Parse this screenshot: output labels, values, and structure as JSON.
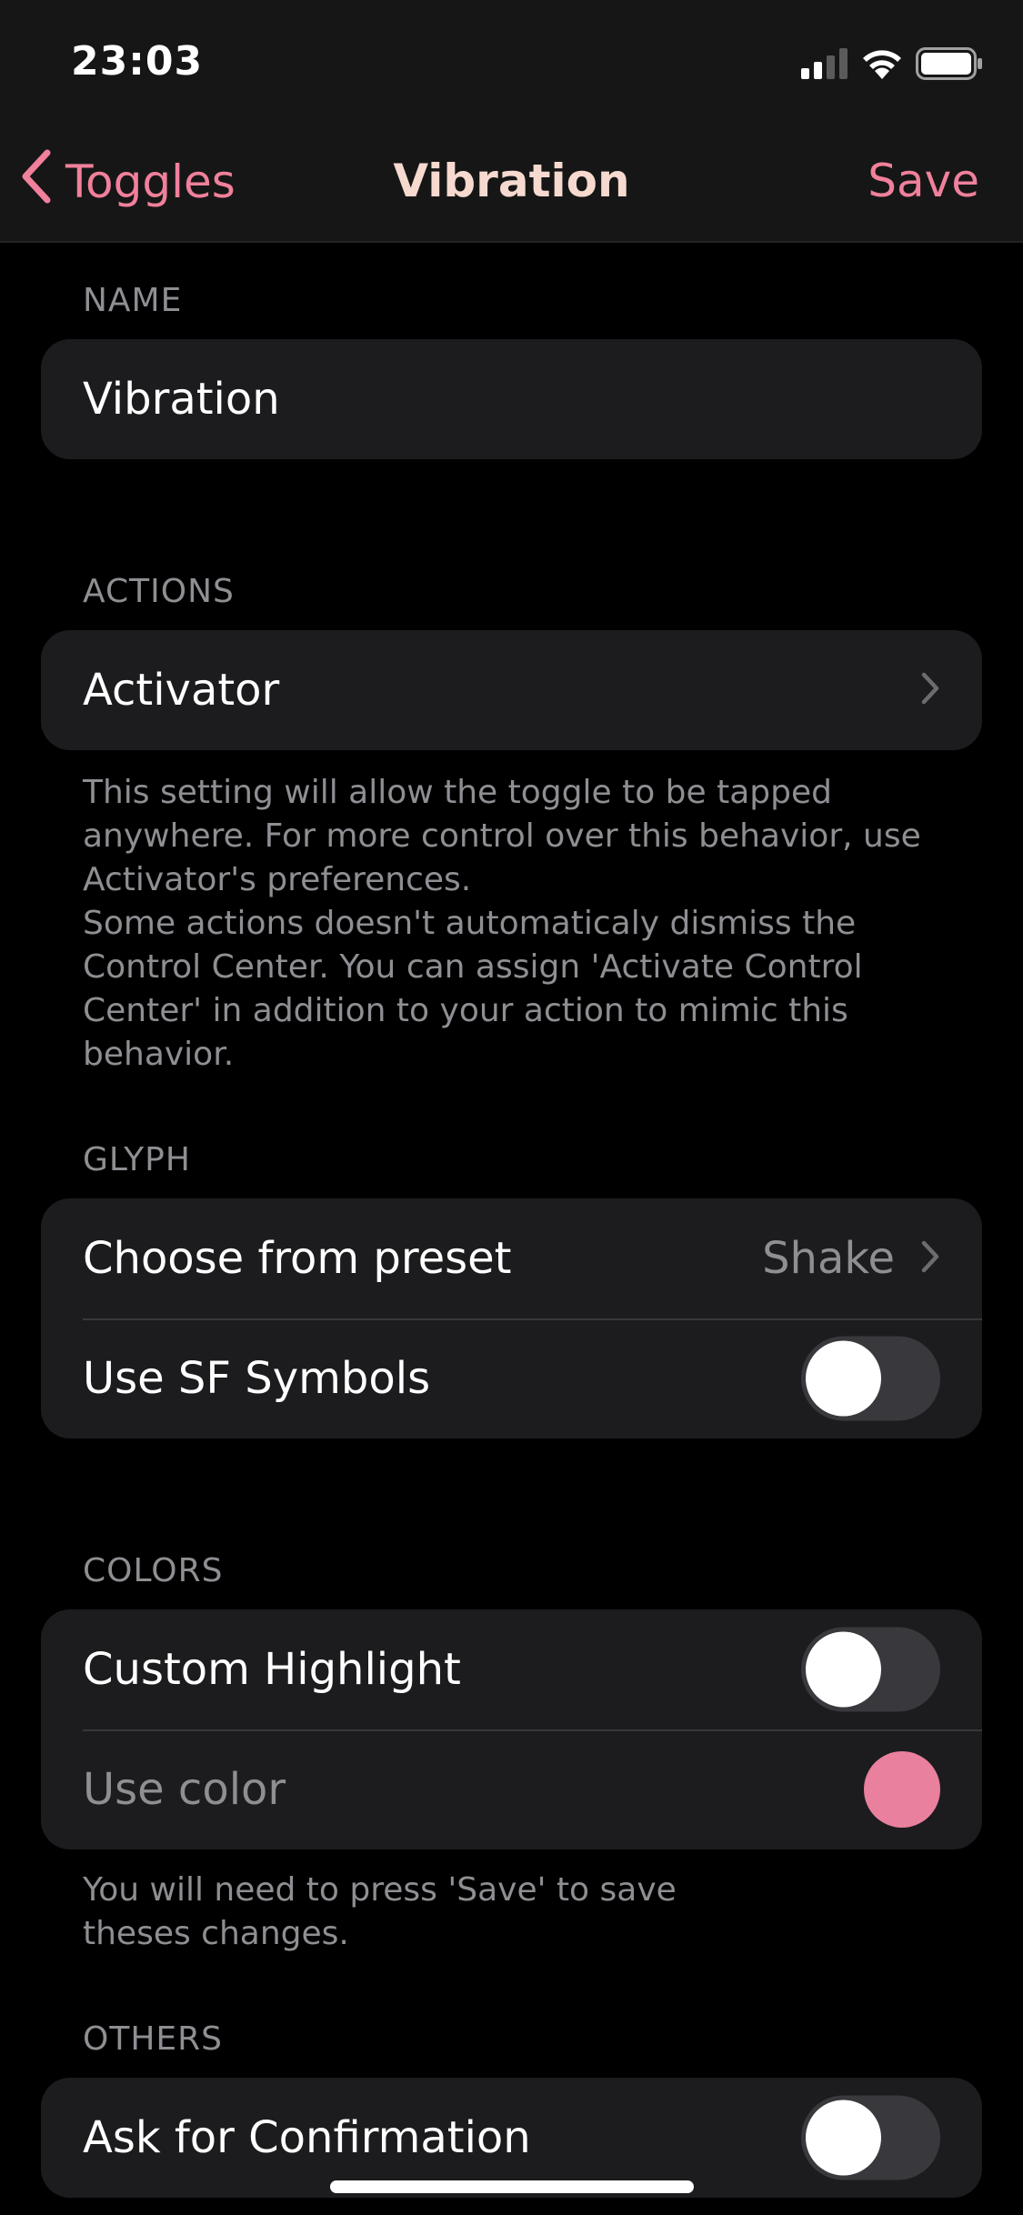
{
  "status_bar": {
    "time": "23:03",
    "icons": [
      "signal-icon",
      "wifi-icon",
      "battery-icon"
    ]
  },
  "nav": {
    "back_label": "Toggles",
    "title": "Vibration",
    "save_label": "Save"
  },
  "sections": {
    "name": {
      "header": "NAME",
      "value": "Vibration"
    },
    "actions": {
      "header": "ACTIONS",
      "row_label": "Activator",
      "footer": "This setting will allow the toggle to be tapped anywhere. For more control over this behavior, use Activator's preferences.\nSome actions doesn't automaticaly dismiss the Control Center. You can assign 'Activate Control Center' in addition to your action to mimic this behavior."
    },
    "glyph": {
      "header": "GLYPH",
      "preset_label": "Choose from preset",
      "preset_value": "Shake",
      "sf_symbols_label": "Use SF Symbols",
      "sf_symbols_on": false
    },
    "colors": {
      "header": "COLORS",
      "custom_highlight_label": "Custom Highlight",
      "custom_highlight_on": false,
      "use_color_label": "Use color",
      "swatch_color": "#e9809d",
      "footer": "You will need to press 'Save' to save theses changes."
    },
    "others": {
      "header": "OTHERS",
      "confirmation_label": "Ask for Confirmation",
      "confirmation_on": false
    }
  },
  "colors": {
    "accent": "#f0809b",
    "title": "#f6d9cf",
    "background": "#000000",
    "cell": "#1c1c1e",
    "secondary_text": "#8e8e93"
  }
}
